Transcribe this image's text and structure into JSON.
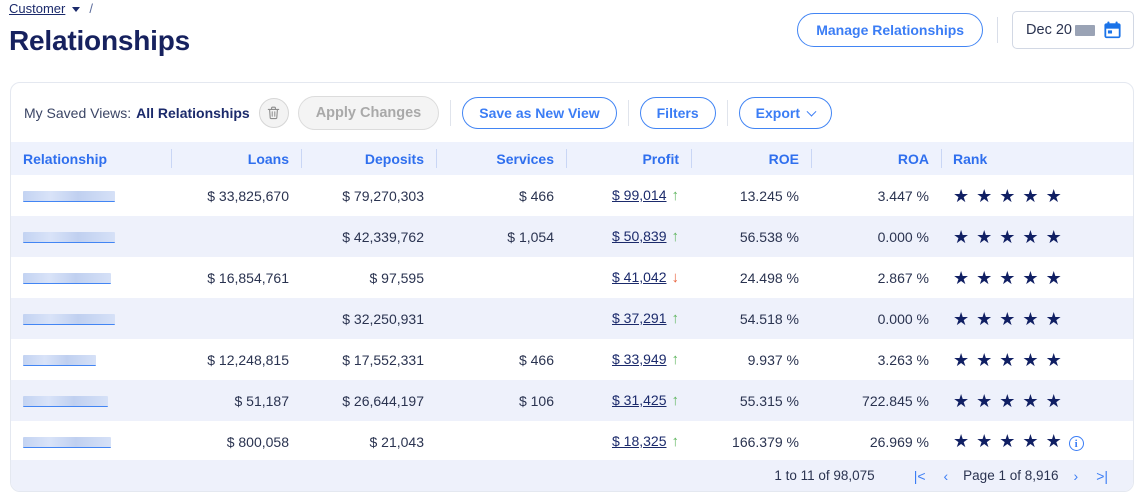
{
  "breadcrumb": {
    "root": "Customer",
    "separator": "/"
  },
  "page_title": "Relationships",
  "header_actions": {
    "manage_label": "Manage Relationships",
    "date_value": "Dec 20",
    "date_icon": "calendar-icon"
  },
  "toolbar": {
    "saved_views_label": "My Saved Views:",
    "saved_views_value": "All Relationships",
    "delete_icon": "trash-icon",
    "apply_changes_label": "Apply Changes",
    "save_as_new_view_label": "Save as New View",
    "filters_label": "Filters",
    "export_label": "Export"
  },
  "table": {
    "columns": [
      {
        "label": "Relationship",
        "align": "l"
      },
      {
        "label": "Loans",
        "align": "r"
      },
      {
        "label": "Deposits",
        "align": "r"
      },
      {
        "label": "Services",
        "align": "r"
      },
      {
        "label": "Profit",
        "align": "r"
      },
      {
        "label": "ROE",
        "align": "r"
      },
      {
        "label": "ROA",
        "align": "r"
      },
      {
        "label": "Rank",
        "align": "l"
      }
    ],
    "rows": [
      {
        "name_redacted_width": 92,
        "loans": "$ 33,825,670",
        "deposits": "$ 79,270,303",
        "services": "$ 466",
        "profit": "$ 99,014",
        "trend": "up",
        "roe": "13.245 %",
        "roa": "3.447 %",
        "rank": 5,
        "info": false
      },
      {
        "name_redacted_width": 92,
        "loans": "",
        "deposits": "$ 42,339,762",
        "services": "$ 1,054",
        "profit": "$ 50,839",
        "trend": "up",
        "roe": "56.538 %",
        "roa": "0.000 %",
        "rank": 5,
        "info": false
      },
      {
        "name_redacted_width": 88,
        "loans": "$ 16,854,761",
        "deposits": "$ 97,595",
        "services": "",
        "profit": "$ 41,042",
        "trend": "down",
        "roe": "24.498 %",
        "roa": "2.867 %",
        "rank": 5,
        "info": false
      },
      {
        "name_redacted_width": 92,
        "loans": "",
        "deposits": "$ 32,250,931",
        "services": "",
        "profit": "$ 37,291",
        "trend": "up",
        "roe": "54.518 %",
        "roa": "0.000 %",
        "rank": 5,
        "info": false
      },
      {
        "name_redacted_width": 73,
        "loans": "$ 12,248,815",
        "deposits": "$ 17,552,331",
        "services": "$ 466",
        "profit": "$ 33,949",
        "trend": "up",
        "roe": "9.937 %",
        "roa": "3.263 %",
        "rank": 5,
        "info": false
      },
      {
        "name_redacted_width": 85,
        "loans": "$ 51,187",
        "deposits": "$ 26,644,197",
        "services": "$ 106",
        "profit": "$ 31,425",
        "trend": "up",
        "roe": "55.315 %",
        "roa": "722.845 %",
        "rank": 5,
        "info": false
      },
      {
        "name_redacted_width": 88,
        "loans": "$ 800,058",
        "deposits": "$ 21,043",
        "services": "",
        "profit": "$ 18,325",
        "trend": "up",
        "roe": "166.379 %",
        "roa": "26.969 %",
        "rank": 5,
        "info": true
      }
    ]
  },
  "pagination": {
    "range_text": "1 to 11 of 98,075",
    "first_label": "|<",
    "prev_label": "‹",
    "page_label": "Page 1 of 8,916",
    "next_label": "›",
    "last_label": ">|"
  },
  "colors": {
    "accent_blue": "#3b7df5",
    "header_blue": "#2f6fee",
    "navy": "#16215e",
    "row_alt": "#eef1fb",
    "trend_up": "#5fb55f",
    "trend_down": "#e8613c"
  },
  "glyphs": {
    "star": "★",
    "info": "i"
  }
}
